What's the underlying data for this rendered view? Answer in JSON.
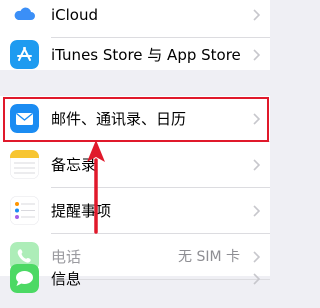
{
  "settings": {
    "group1": {
      "icloud_label": "iCloud",
      "itunes_label": "iTunes Store 与 App Store"
    },
    "group2": {
      "mail_label": "邮件、通讯录、日历",
      "notes_label": "备忘录",
      "reminders_label": "提醒事项",
      "phone_label": "电话",
      "phone_value": "无 SIM 卡",
      "messages_label": "信息"
    }
  },
  "annotation": {
    "highlight_color": "#e0192b"
  }
}
